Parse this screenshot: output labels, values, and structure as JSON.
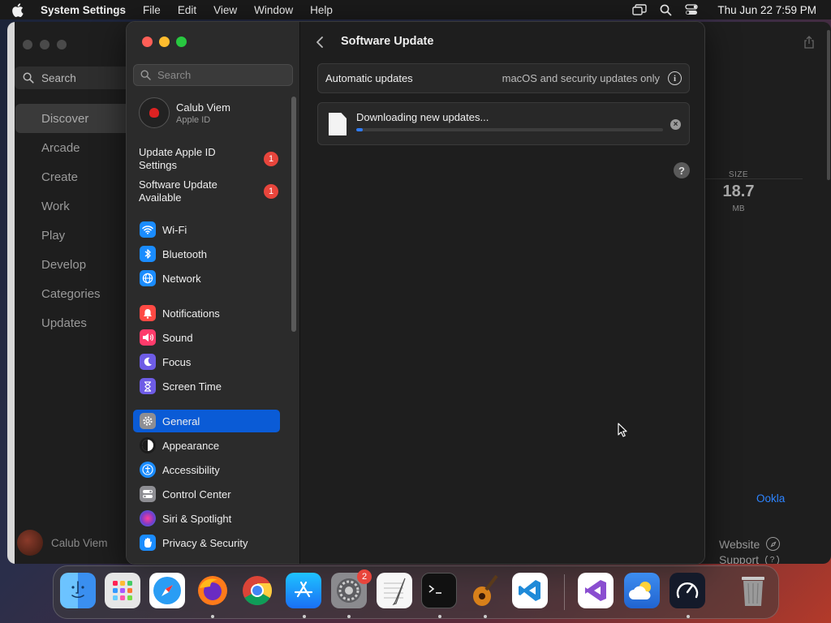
{
  "menubar": {
    "app_name": "System Settings",
    "menus": [
      "File",
      "Edit",
      "View",
      "Window",
      "Help"
    ],
    "clock": "Thu Jun 22  7:59 PM"
  },
  "background_window": {
    "search_placeholder": "Search",
    "nav": [
      "Discover",
      "Arcade",
      "Create",
      "Work",
      "Play",
      "Develop",
      "Categories",
      "Updates"
    ],
    "active_nav": "Discover",
    "user_name": "Calub Viem",
    "size_label": "SIZE",
    "size_value": "18.7",
    "size_unit": "MB",
    "developer": "Ookla",
    "links": [
      "Website",
      "Support"
    ]
  },
  "sidebar": {
    "search_placeholder": "Search",
    "account": {
      "name": "Calub Viem",
      "subtitle": "Apple ID"
    },
    "alerts": [
      {
        "label": "Update Apple ID Settings",
        "badge": "1"
      },
      {
        "label": "Software Update Available",
        "badge": "1"
      }
    ],
    "items": [
      {
        "label": "Wi-Fi",
        "icon": "wifi-icon",
        "color": "#1a8cff"
      },
      {
        "label": "Bluetooth",
        "icon": "bluetooth-icon",
        "color": "#1a8cff"
      },
      {
        "label": "Network",
        "icon": "globe-icon",
        "color": "#1a8cff"
      },
      {
        "label": "Notifications",
        "icon": "bell-icon",
        "color": "#ff4a44"
      },
      {
        "label": "Sound",
        "icon": "speaker-icon",
        "color": "#ff3b6b"
      },
      {
        "label": "Focus",
        "icon": "moon-icon",
        "color": "#6e5ce6"
      },
      {
        "label": "Screen Time",
        "icon": "hourglass-icon",
        "color": "#6e5ce6"
      },
      {
        "label": "General",
        "icon": "gear-icon",
        "color": "#8e8e93"
      },
      {
        "label": "Appearance",
        "icon": "appearance-icon",
        "color": "#1c1c1c"
      },
      {
        "label": "Accessibility",
        "icon": "accessibility-icon",
        "color": "#1a8cff"
      },
      {
        "label": "Control Center",
        "icon": "toggles-icon",
        "color": "#8e8e93"
      },
      {
        "label": "Siri & Spotlight",
        "icon": "siri-icon",
        "color": "#7a3cc8"
      },
      {
        "label": "Privacy & Security",
        "icon": "hand-icon",
        "color": "#1a8cff"
      }
    ],
    "active": "General"
  },
  "main": {
    "title": "Software Update",
    "automatic_updates_label": "Automatic updates",
    "automatic_updates_value": "macOS and security updates only",
    "download_status": "Downloading new updates...",
    "download_progress": 0.02
  },
  "dock": {
    "apps": [
      "Finder",
      "Launchpad",
      "Safari",
      "Firefox",
      "Chrome",
      "App Store",
      "System Settings",
      "TextEdit",
      "Terminal",
      "GarageBand",
      "Visual Studio Code",
      "Visual Studio",
      "Weather",
      "Speedtest",
      "Trash"
    ],
    "system_settings_badge": "2"
  }
}
